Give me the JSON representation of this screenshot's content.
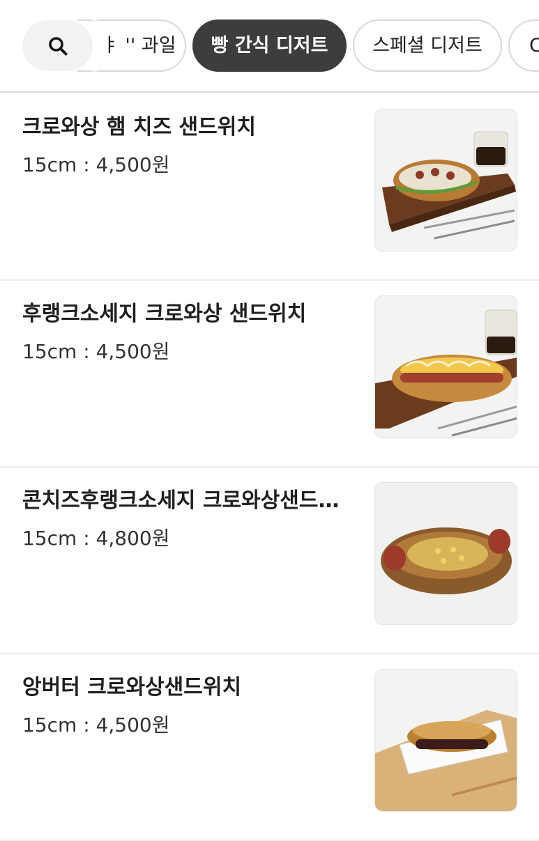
{
  "search": {
    "icon": "search-icon"
  },
  "categories": [
    {
      "label": "ㅑ '' 과일",
      "state": "partial"
    },
    {
      "label": "빵 간식 디저트",
      "state": "active"
    },
    {
      "label": "스페셜 디저트",
      "state": "normal"
    },
    {
      "label": "C",
      "state": "partial"
    }
  ],
  "colors": {
    "active_chip_bg": "#3d3d3d",
    "chip_border": "#d8d8d8",
    "search_bg": "#f2f2f2"
  },
  "items": [
    {
      "name": "크로와상 햄 치즈 샌드위치",
      "price": "15cm : 4,500원",
      "image": "croissant-ham-cheese-sandwich-photo"
    },
    {
      "name": "후랭크소세지 크로와상 샌드위치",
      "price": "15cm : 4,500원",
      "image": "frank-sausage-croissant-photo"
    },
    {
      "name": "콘치즈후랭크소세지 크로와상샌드위치",
      "price": "15cm : 4,800원",
      "image": "corn-cheese-sausage-croissant-photo"
    },
    {
      "name": "앙버터 크로와상샌드위치",
      "price": "15cm : 4,500원",
      "image": "anbutter-croissant-photo"
    }
  ]
}
